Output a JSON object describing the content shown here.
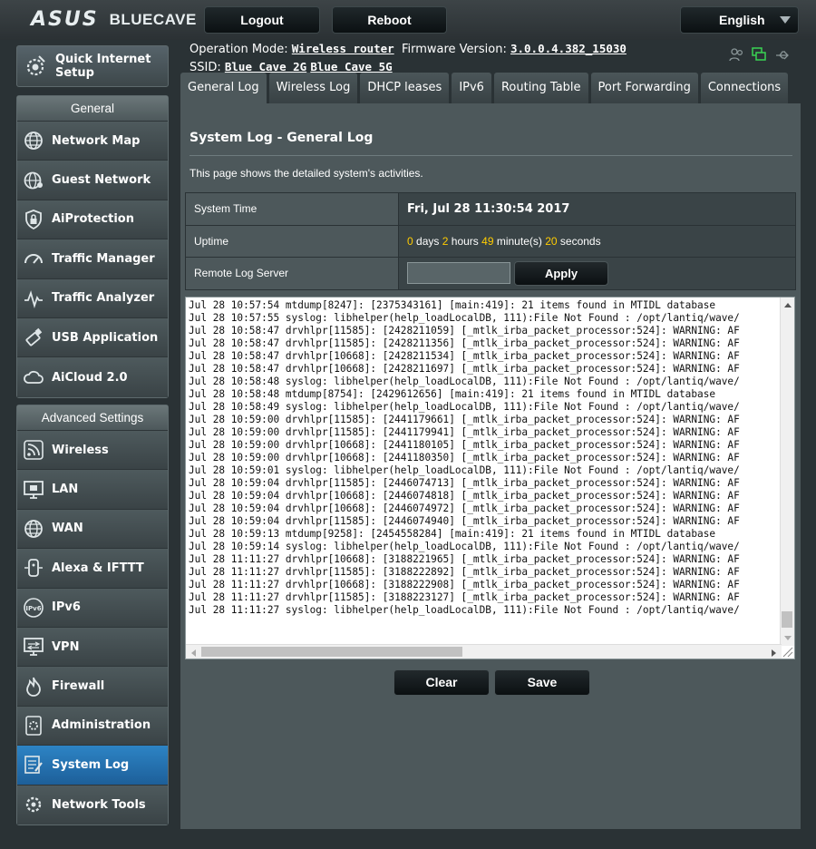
{
  "brand": {
    "logo": "ASUS",
    "model": "BLUECAVE"
  },
  "top": {
    "logout": "Logout",
    "reboot": "Reboot",
    "language": "English"
  },
  "info": {
    "op_label": "Operation Mode:",
    "op_value": "Wireless router",
    "fw_label": "Firmware Version:",
    "fw_value": "3.0.0.4.382_15030",
    "ssid_label": "SSID:",
    "ssid1": "Blue_Cave_2G",
    "ssid2": "Blue_Cave_5G"
  },
  "sidebar": {
    "qis": "Quick Internet Setup",
    "general_header": "General",
    "general": [
      "Network Map",
      "Guest Network",
      "AiProtection",
      "Traffic Manager",
      "Traffic Analyzer",
      "USB Application",
      "AiCloud 2.0"
    ],
    "advanced_header": "Advanced Settings",
    "advanced": [
      "Wireless",
      "LAN",
      "WAN",
      "Alexa & IFTTT",
      "IPv6",
      "VPN",
      "Firewall",
      "Administration",
      "System Log",
      "Network Tools"
    ]
  },
  "tabs": [
    "General Log",
    "Wireless Log",
    "DHCP leases",
    "IPv6",
    "Routing Table",
    "Port Forwarding",
    "Connections"
  ],
  "panel": {
    "title": "System Log - General Log",
    "desc": "This page shows the detailed system's activities.",
    "system_time_label": "System Time",
    "system_time": "Fri, Jul 28 11:30:54 2017",
    "uptime_label": "Uptime",
    "uptime": {
      "days": "0",
      "days_l": "days",
      "hours": "2",
      "hours_l": "hours",
      "minutes": "49",
      "minutes_l": "minute(s)",
      "seconds": "20",
      "seconds_l": "seconds"
    },
    "remote_label": "Remote Log Server",
    "apply": "Apply",
    "clear": "Clear",
    "save": "Save"
  },
  "log": [
    "Jul 28 10:57:54 mtdump[8247]: [2375343161] [main:419]: 21 items found in MTIDL database",
    "Jul 28 10:57:55 syslog: libhelper(help_loadLocalDB, 111):File Not Found : /opt/lantiq/wave/",
    "Jul 28 10:58:47 drvhlpr[11585]: [2428211059] [_mtlk_irba_packet_processor:524]: WARNING: AF",
    "Jul 28 10:58:47 drvhlpr[11585]: [2428211356] [_mtlk_irba_packet_processor:524]: WARNING: AF",
    "Jul 28 10:58:47 drvhlpr[10668]: [2428211534] [_mtlk_irba_packet_processor:524]: WARNING: AF",
    "Jul 28 10:58:47 drvhlpr[10668]: [2428211697] [_mtlk_irba_packet_processor:524]: WARNING: AF",
    "Jul 28 10:58:48 syslog: libhelper(help_loadLocalDB, 111):File Not Found : /opt/lantiq/wave/",
    "Jul 28 10:58:48 mtdump[8754]: [2429612656] [main:419]: 21 items found in MTIDL database",
    "Jul 28 10:58:49 syslog: libhelper(help_loadLocalDB, 111):File Not Found : /opt/lantiq/wave/",
    "Jul 28 10:59:00 drvhlpr[11585]: [2441179661] [_mtlk_irba_packet_processor:524]: WARNING: AF",
    "Jul 28 10:59:00 drvhlpr[11585]: [2441179941] [_mtlk_irba_packet_processor:524]: WARNING: AF",
    "Jul 28 10:59:00 drvhlpr[10668]: [2441180105] [_mtlk_irba_packet_processor:524]: WARNING: AF",
    "Jul 28 10:59:00 drvhlpr[10668]: [2441180350] [_mtlk_irba_packet_processor:524]: WARNING: AF",
    "Jul 28 10:59:01 syslog: libhelper(help_loadLocalDB, 111):File Not Found : /opt/lantiq/wave/",
    "Jul 28 10:59:04 drvhlpr[11585]: [2446074713] [_mtlk_irba_packet_processor:524]: WARNING: AF",
    "Jul 28 10:59:04 drvhlpr[10668]: [2446074818] [_mtlk_irba_packet_processor:524]: WARNING: AF",
    "Jul 28 10:59:04 drvhlpr[10668]: [2446074972] [_mtlk_irba_packet_processor:524]: WARNING: AF",
    "Jul 28 10:59:04 drvhlpr[11585]: [2446074940] [_mtlk_irba_packet_processor:524]: WARNING: AF",
    "Jul 28 10:59:13 mtdump[9258]: [2454558284] [main:419]: 21 items found in MTIDL database",
    "Jul 28 10:59:14 syslog: libhelper(help_loadLocalDB, 111):File Not Found : /opt/lantiq/wave/",
    "Jul 28 11:11:27 drvhlpr[10668]: [3188221965] [_mtlk_irba_packet_processor:524]: WARNING: AF",
    "Jul 28 11:11:27 drvhlpr[11585]: [3188222892] [_mtlk_irba_packet_processor:524]: WARNING: AF",
    "Jul 28 11:11:27 drvhlpr[10668]: [3188222908] [_mtlk_irba_packet_processor:524]: WARNING: AF",
    "Jul 28 11:11:27 drvhlpr[11585]: [3188223127] [_mtlk_irba_packet_processor:524]: WARNING: AF",
    "Jul 28 11:11:27 syslog: libhelper(help_loadLocalDB, 111):File Not Found : /opt/lantiq/wave/"
  ],
  "icons": {
    "qis": "gear-wand-icon",
    "network_map": "globe-icon",
    "guest_network": "globe-user-icon",
    "aiprotection": "shield-lock-icon",
    "traffic_manager": "gauge-icon",
    "traffic_analyzer": "chart-wave-icon",
    "usb_application": "usb-stick-icon",
    "aicloud": "cloud-icon",
    "wireless": "wifi-icon",
    "lan": "monitor-lan-icon",
    "wan": "globe-wan-icon",
    "alexa": "device-icon",
    "ipv6": "ipv6-icon",
    "vpn": "monitor-vpn-icon",
    "firewall": "flame-icon",
    "administration": "admin-gear-icon",
    "system_log": "log-pencil-icon",
    "network_tools": "tools-gear-icon"
  },
  "colors": {
    "accent": "#fc0",
    "active": "#2d84c5",
    "status_green": "#39d353"
  }
}
